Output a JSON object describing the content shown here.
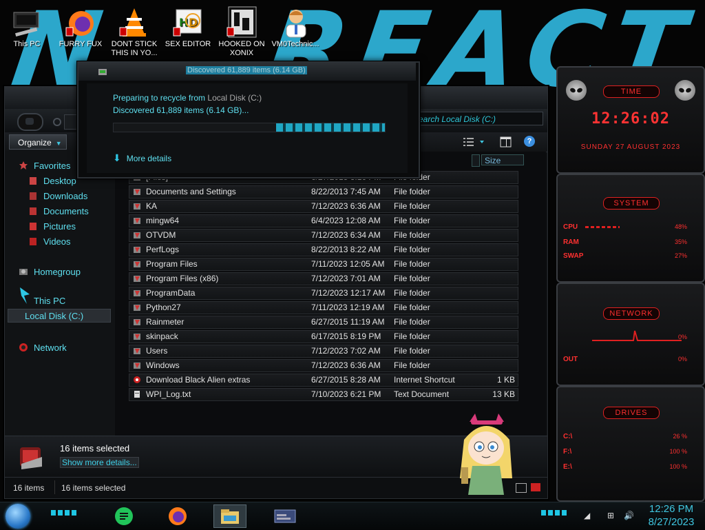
{
  "desktop": {
    "icons": [
      {
        "label": "This PC"
      },
      {
        "label": "FURRY FUX"
      },
      {
        "label": "DONT STICK THIS IN YO..."
      },
      {
        "label": "SEX EDITOR"
      },
      {
        "label": "HOOKED ON XONIX"
      },
      {
        "label": "VM0Technic..."
      }
    ]
  },
  "explorer": {
    "search_placeholder": "Search Local Disk (C:)",
    "organize_label": "Organize",
    "column_size": "Size",
    "nav": {
      "favorites": "Favorites",
      "desktop": "Desktop",
      "downloads": "Downloads",
      "documents": "Documents",
      "pictures": "Pictures",
      "videos": "Videos",
      "homegroup": "Homegroup",
      "this_pc": "This PC",
      "local_disk": "Local Disk (C:)",
      "network": "Network"
    },
    "files": [
      {
        "name": "[Files]",
        "date": "6/27/2015 3:16 PM",
        "type": "File folder",
        "size": ""
      },
      {
        "name": "Documents and Settings",
        "date": "8/22/2013 7:45 AM",
        "type": "File folder",
        "size": ""
      },
      {
        "name": "KA",
        "date": "7/12/2023 6:36 AM",
        "type": "File folder",
        "size": ""
      },
      {
        "name": "mingw64",
        "date": "6/4/2023 12:08 AM",
        "type": "File folder",
        "size": ""
      },
      {
        "name": "OTVDM",
        "date": "7/12/2023 6:34 AM",
        "type": "File folder",
        "size": ""
      },
      {
        "name": "PerfLogs",
        "date": "8/22/2013 8:22 AM",
        "type": "File folder",
        "size": ""
      },
      {
        "name": "Program Files",
        "date": "7/11/2023 12:05 AM",
        "type": "File folder",
        "size": ""
      },
      {
        "name": "Program Files (x86)",
        "date": "7/12/2023 7:01 AM",
        "type": "File folder",
        "size": ""
      },
      {
        "name": "ProgramData",
        "date": "7/12/2023 12:17 AM",
        "type": "File folder",
        "size": ""
      },
      {
        "name": "Python27",
        "date": "7/11/2023 12:19 AM",
        "type": "File folder",
        "size": ""
      },
      {
        "name": "Rainmeter",
        "date": "6/27/2015 11:19 AM",
        "type": "File folder",
        "size": ""
      },
      {
        "name": "skinpack",
        "date": "6/17/2015 8:19 PM",
        "type": "File folder",
        "size": ""
      },
      {
        "name": "Users",
        "date": "7/12/2023 7:02 AM",
        "type": "File folder",
        "size": ""
      },
      {
        "name": "Windows",
        "date": "7/12/2023 6:36 AM",
        "type": "File folder",
        "size": ""
      },
      {
        "name": "Download Black Alien extras",
        "date": "6/27/2015 8:28 AM",
        "type": "Internet Shortcut",
        "size": "1 KB"
      },
      {
        "name": "WPI_Log.txt",
        "date": "7/10/2023 6:21 PM",
        "type": "Text Document",
        "size": "13 KB"
      }
    ],
    "details": {
      "selected": "16 items selected",
      "show_more": "Show more details..."
    },
    "status": {
      "count": "16 items",
      "selected": "16 items selected"
    }
  },
  "dialog": {
    "title": "Discovered 61,889 items (6.14 GB)",
    "preparing": "Preparing to recycle from",
    "source": "Local Disk (C:)",
    "discovered": "Discovered 61,889 items (6.14 GB)...",
    "progress": 0.4,
    "more_details": "More details"
  },
  "gadgets": {
    "time_title": "TIME",
    "time": "12:26:02",
    "date": "SUNDAY 27 AUGUST 2023",
    "system_title": "SYSTEM",
    "cpu_label": "CPU",
    "cpu_val": "48%",
    "ram_label": "RAM",
    "ram_val": "35%",
    "swap_label": "SWAP",
    "swap_val": "27%",
    "network_title": "NETWORK",
    "net_in": "0%",
    "net_out_label": "OUT",
    "net_out": "0%",
    "drives_title": "DRIVES",
    "drive_c_label": "C:\\",
    "drive_c_val": "26 %",
    "drive_f_label": "F:\\",
    "drive_f_val": "100 %",
    "drive_e_label": "E:\\",
    "drive_e_val": "100 %"
  },
  "taskbar": {
    "time": "12:26 PM",
    "date": "8/27/2023"
  },
  "colors": {
    "accent": "#2ec6e4",
    "gadget_red": "#ff3030"
  }
}
